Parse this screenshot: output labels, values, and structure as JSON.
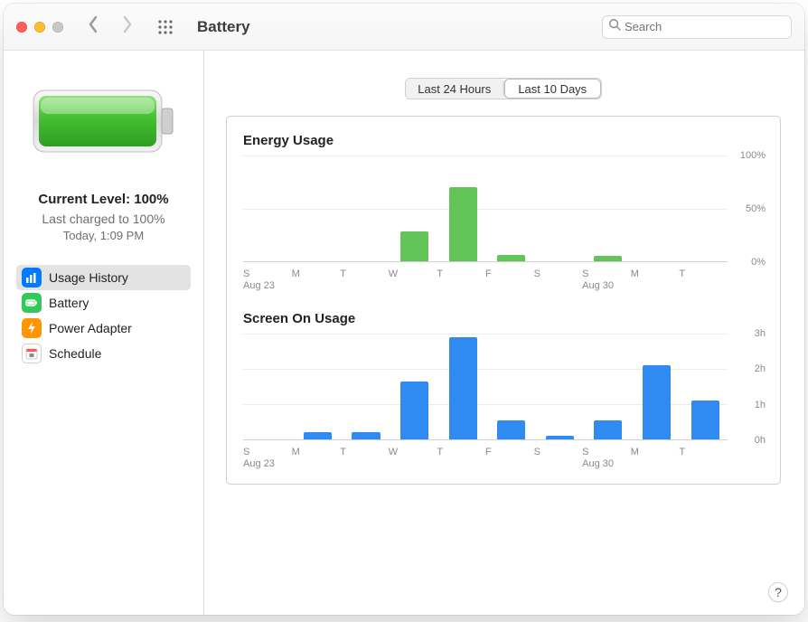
{
  "window": {
    "title": "Battery"
  },
  "search": {
    "placeholder": "Search",
    "value": ""
  },
  "sidebar": {
    "level_label": "Current Level: 100%",
    "last_charged": "Last charged to 100%",
    "last_charged_time": "Today, 1:09 PM",
    "items": [
      {
        "label": "Usage History"
      },
      {
        "label": "Battery"
      },
      {
        "label": "Power Adapter"
      },
      {
        "label": "Schedule"
      }
    ]
  },
  "segmented": {
    "last24": "Last 24 Hours",
    "last10": "Last 10 Days"
  },
  "charts": {
    "energy": {
      "title": "Energy Usage",
      "y": {
        "l0": "0%",
        "l50": "50%",
        "l100": "100%"
      }
    },
    "screen": {
      "title": "Screen On Usage",
      "y": {
        "l0": "0h",
        "l1": "1h",
        "l2": "2h",
        "l3": "3h"
      }
    },
    "xcats": {
      "c0": "S",
      "c1": "M",
      "c2": "T",
      "c3": "W",
      "c4": "T",
      "c5": "F",
      "c6": "S",
      "c7": "S",
      "c8": "M",
      "c9": "T"
    },
    "xsub": {
      "s0": "Aug 23",
      "s7": "Aug 30"
    }
  },
  "help": {
    "glyph": "?"
  },
  "chart_data": [
    {
      "type": "bar",
      "title": "Energy Usage",
      "ylabel": "%",
      "xlabel": "",
      "ylim": [
        0,
        100
      ],
      "categories": [
        "S",
        "M",
        "T",
        "W",
        "T",
        "F",
        "S",
        "S",
        "M",
        "T"
      ],
      "category_dates": [
        "Aug 23",
        "",
        "",
        "",
        "",
        "",
        "",
        "Aug 30",
        "",
        ""
      ],
      "values": [
        0,
        0,
        0,
        28,
        70,
        6,
        0,
        5,
        0,
        0
      ],
      "color": "#63c558"
    },
    {
      "type": "bar",
      "title": "Screen On Usage",
      "ylabel": "hours",
      "xlabel": "",
      "ylim": [
        0,
        3
      ],
      "categories": [
        "S",
        "M",
        "T",
        "W",
        "T",
        "F",
        "S",
        "S",
        "M",
        "T"
      ],
      "category_dates": [
        "Aug 23",
        "",
        "",
        "",
        "",
        "",
        "",
        "Aug 30",
        "",
        ""
      ],
      "values": [
        0,
        0.2,
        0.2,
        1.65,
        2.9,
        0.55,
        0.1,
        0.55,
        2.1,
        1.1
      ],
      "color": "#2f8af2"
    }
  ]
}
